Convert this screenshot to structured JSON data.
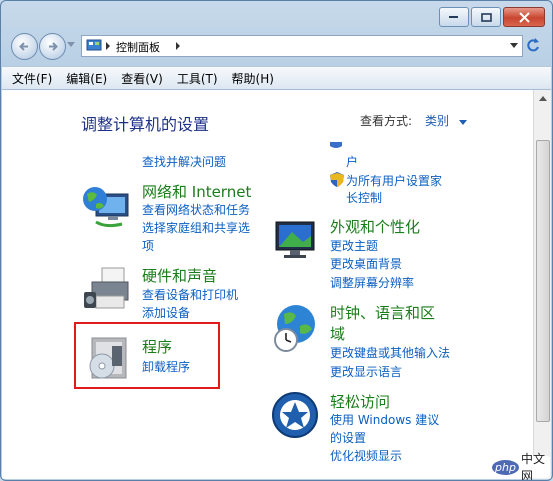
{
  "window": {
    "address_crumb": "控制面板"
  },
  "menu": [
    "文件(F)",
    "编辑(E)",
    "查看(V)",
    "工具(T)",
    "帮助(H)"
  ],
  "page": {
    "heading": "调整计算机的设置",
    "view_by_label": "查看方式:",
    "view_by_value": "类别"
  },
  "left": {
    "top_link": "查找并解决问题",
    "network": {
      "title": "网络和 Internet",
      "links": [
        "查看网络状态和任务",
        "选择家庭组和共享选",
        "项"
      ]
    },
    "hardware": {
      "title": "硬件和声音",
      "links": [
        "查看设备和打印机",
        "添加设备"
      ]
    },
    "programs": {
      "title": "程序",
      "links": [
        "卸载程序"
      ]
    }
  },
  "right": {
    "top_partial": "户",
    "parental": [
      "为所有用户设置家",
      "长控制"
    ],
    "appearance": {
      "title": "外观和个性化",
      "links": [
        "更改主题",
        "更改桌面背景",
        "调整屏幕分辨率"
      ]
    },
    "clock": {
      "title_line1": "时钟、语言和区",
      "title_line2": "域",
      "links": [
        "更改键盘或其他输入法",
        "更改显示语言"
      ]
    },
    "ease": {
      "title": "轻松访问",
      "links": [
        "使用 Windows 建议",
        "的设置",
        "优化视频显示"
      ]
    }
  },
  "watermark": {
    "brand": "php",
    "text": "中文网"
  }
}
